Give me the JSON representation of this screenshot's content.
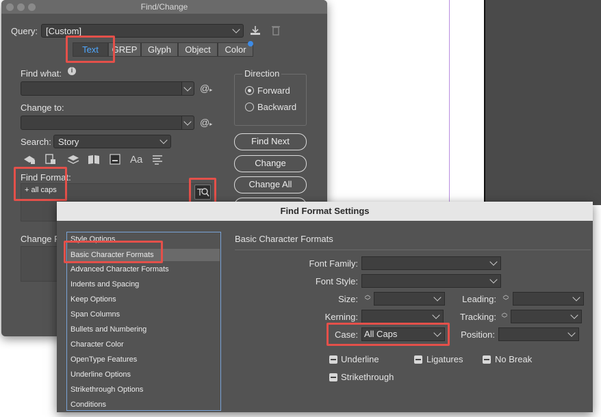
{
  "find_change": {
    "title": "Find/Change",
    "query_label": "Query:",
    "query_value": "[Custom]",
    "tabs": [
      {
        "label": "Text"
      },
      {
        "label": "GREP"
      },
      {
        "label": "Glyph"
      },
      {
        "label": "Object"
      },
      {
        "label": "Color"
      }
    ],
    "find_what_label": "Find what:",
    "change_to_label": "Change to:",
    "search_label": "Search:",
    "search_value": "Story",
    "find_format_label": "Find Format:",
    "find_format_value": "+ all caps",
    "change_format_label": "Change F",
    "direction": {
      "title": "Direction",
      "forward": "Forward",
      "backward": "Backward"
    },
    "buttons": {
      "find_next": "Find Next",
      "change": "Change",
      "change_all": "Change All"
    },
    "icons": [
      "info-icon",
      "save-query-icon",
      "delete-query-icon",
      "special-chars-icon",
      "lock-layers-icon",
      "lock-stories-icon",
      "hidden-layers-icon",
      "master-pages-icon",
      "footnotes-icon",
      "case-sensitive-icon",
      "whole-word-icon",
      "find-format-settings-icon"
    ]
  },
  "find_format_settings": {
    "title": "Find Format Settings",
    "categories": [
      {
        "label": "Style Options"
      },
      {
        "label": "Basic Character Formats"
      },
      {
        "label": "Advanced Character Formats"
      },
      {
        "label": "Indents and Spacing"
      },
      {
        "label": "Keep Options"
      },
      {
        "label": "Span Columns"
      },
      {
        "label": "Bullets and Numbering"
      },
      {
        "label": "Character Color"
      },
      {
        "label": "OpenType Features"
      },
      {
        "label": "Underline Options"
      },
      {
        "label": "Strikethrough Options"
      },
      {
        "label": "Conditions"
      }
    ],
    "section_title": "Basic Character Formats",
    "font_family_label": "Font Family:",
    "font_style_label": "Font Style:",
    "size_label": "Size:",
    "leading_label": "Leading:",
    "kerning_label": "Kerning:",
    "tracking_label": "Tracking:",
    "case_label": "Case:",
    "case_value": "All Caps",
    "position_label": "Position:",
    "checkboxes": {
      "underline": "Underline",
      "ligatures": "Ligatures",
      "no_break": "No Break",
      "strikethrough": "Strikethrough"
    }
  },
  "colors": {
    "panel": "#535353",
    "accent_blue": "#4fa8ff",
    "highlight_red": "#e4504a"
  }
}
